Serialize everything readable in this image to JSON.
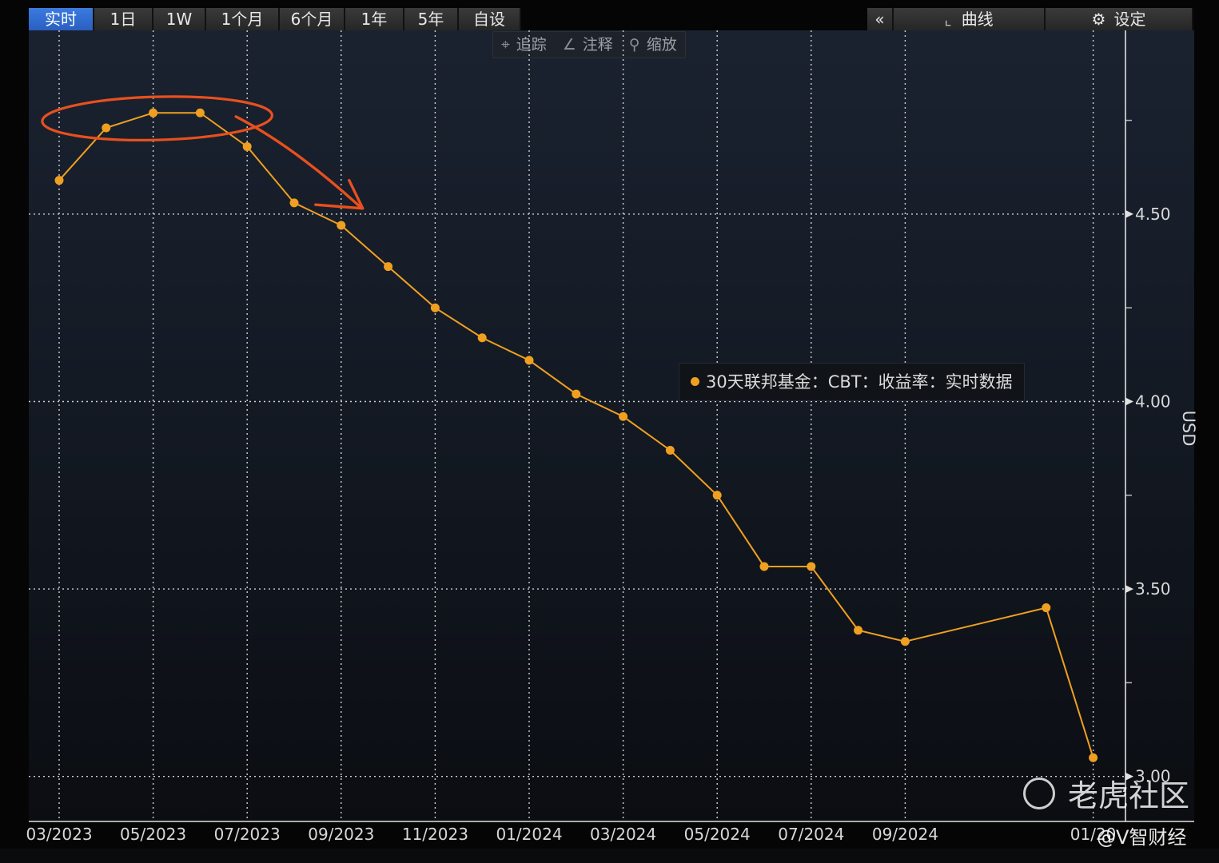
{
  "toolbar": {
    "range_tabs": [
      "实时",
      "1日",
      "1W",
      "1个月",
      "6个月",
      "1年",
      "5年",
      "自设"
    ],
    "active_tab": "实时",
    "collapse_label": "«",
    "curve_label": "曲线",
    "settings_label": "设定",
    "tools": {
      "track": "追踪",
      "annotate": "注释",
      "zoom": "缩放"
    }
  },
  "legend": {
    "label": "30天联邦基金：CBT：收益率：实时数据",
    "color": "#f0a020"
  },
  "watermarks": {
    "primary": "老虎社区",
    "secondary": "@V智财经"
  },
  "icons": [
    "collapse-icon",
    "curve-icon",
    "gear-icon",
    "crosshair-icon",
    "pen-icon",
    "magnifier-icon"
  ],
  "chart_data": {
    "type": "line",
    "title": "",
    "xlabel": "",
    "ylabel": "USD",
    "x_tick_labels": [
      "03/2023",
      "05/2023",
      "07/2023",
      "09/2023",
      "11/2023",
      "01/2024",
      "03/2024",
      "05/2024",
      "07/2024",
      "09/2024",
      "01/20"
    ],
    "y_tick_labels": [
      "4.50",
      "4.00",
      "3.50",
      "3.00"
    ],
    "ylim": [
      2.88,
      4.99
    ],
    "grid": true,
    "x": [
      "03/2023",
      "04/2023",
      "05/2023",
      "06/2023",
      "07/2023",
      "08/2023",
      "09/2023",
      "10/2023",
      "11/2023",
      "12/2023",
      "01/2024",
      "02/2024",
      "03/2024",
      "04/2024",
      "05/2024",
      "06/2024",
      "07/2024",
      "08/2024",
      "09/2024",
      "12/2024",
      "01/2025"
    ],
    "series": [
      {
        "name": "30天联邦基金：CBT：收益率：实时数据",
        "color": "#f0a020",
        "values": [
          4.59,
          4.73,
          4.77,
          4.77,
          4.68,
          4.53,
          4.47,
          4.36,
          4.25,
          4.17,
          4.11,
          4.02,
          3.96,
          3.87,
          3.75,
          3.56,
          3.56,
          3.39,
          3.36,
          3.45,
          3.05
        ]
      }
    ],
    "annotations": [
      {
        "type": "ellipse-highlight",
        "color": "#e8501e",
        "around": [
          "04/2023",
          "06/2023"
        ]
      },
      {
        "type": "arrow",
        "color": "#e8501e",
        "from": "07/2023",
        "to": "09/2023"
      }
    ]
  }
}
